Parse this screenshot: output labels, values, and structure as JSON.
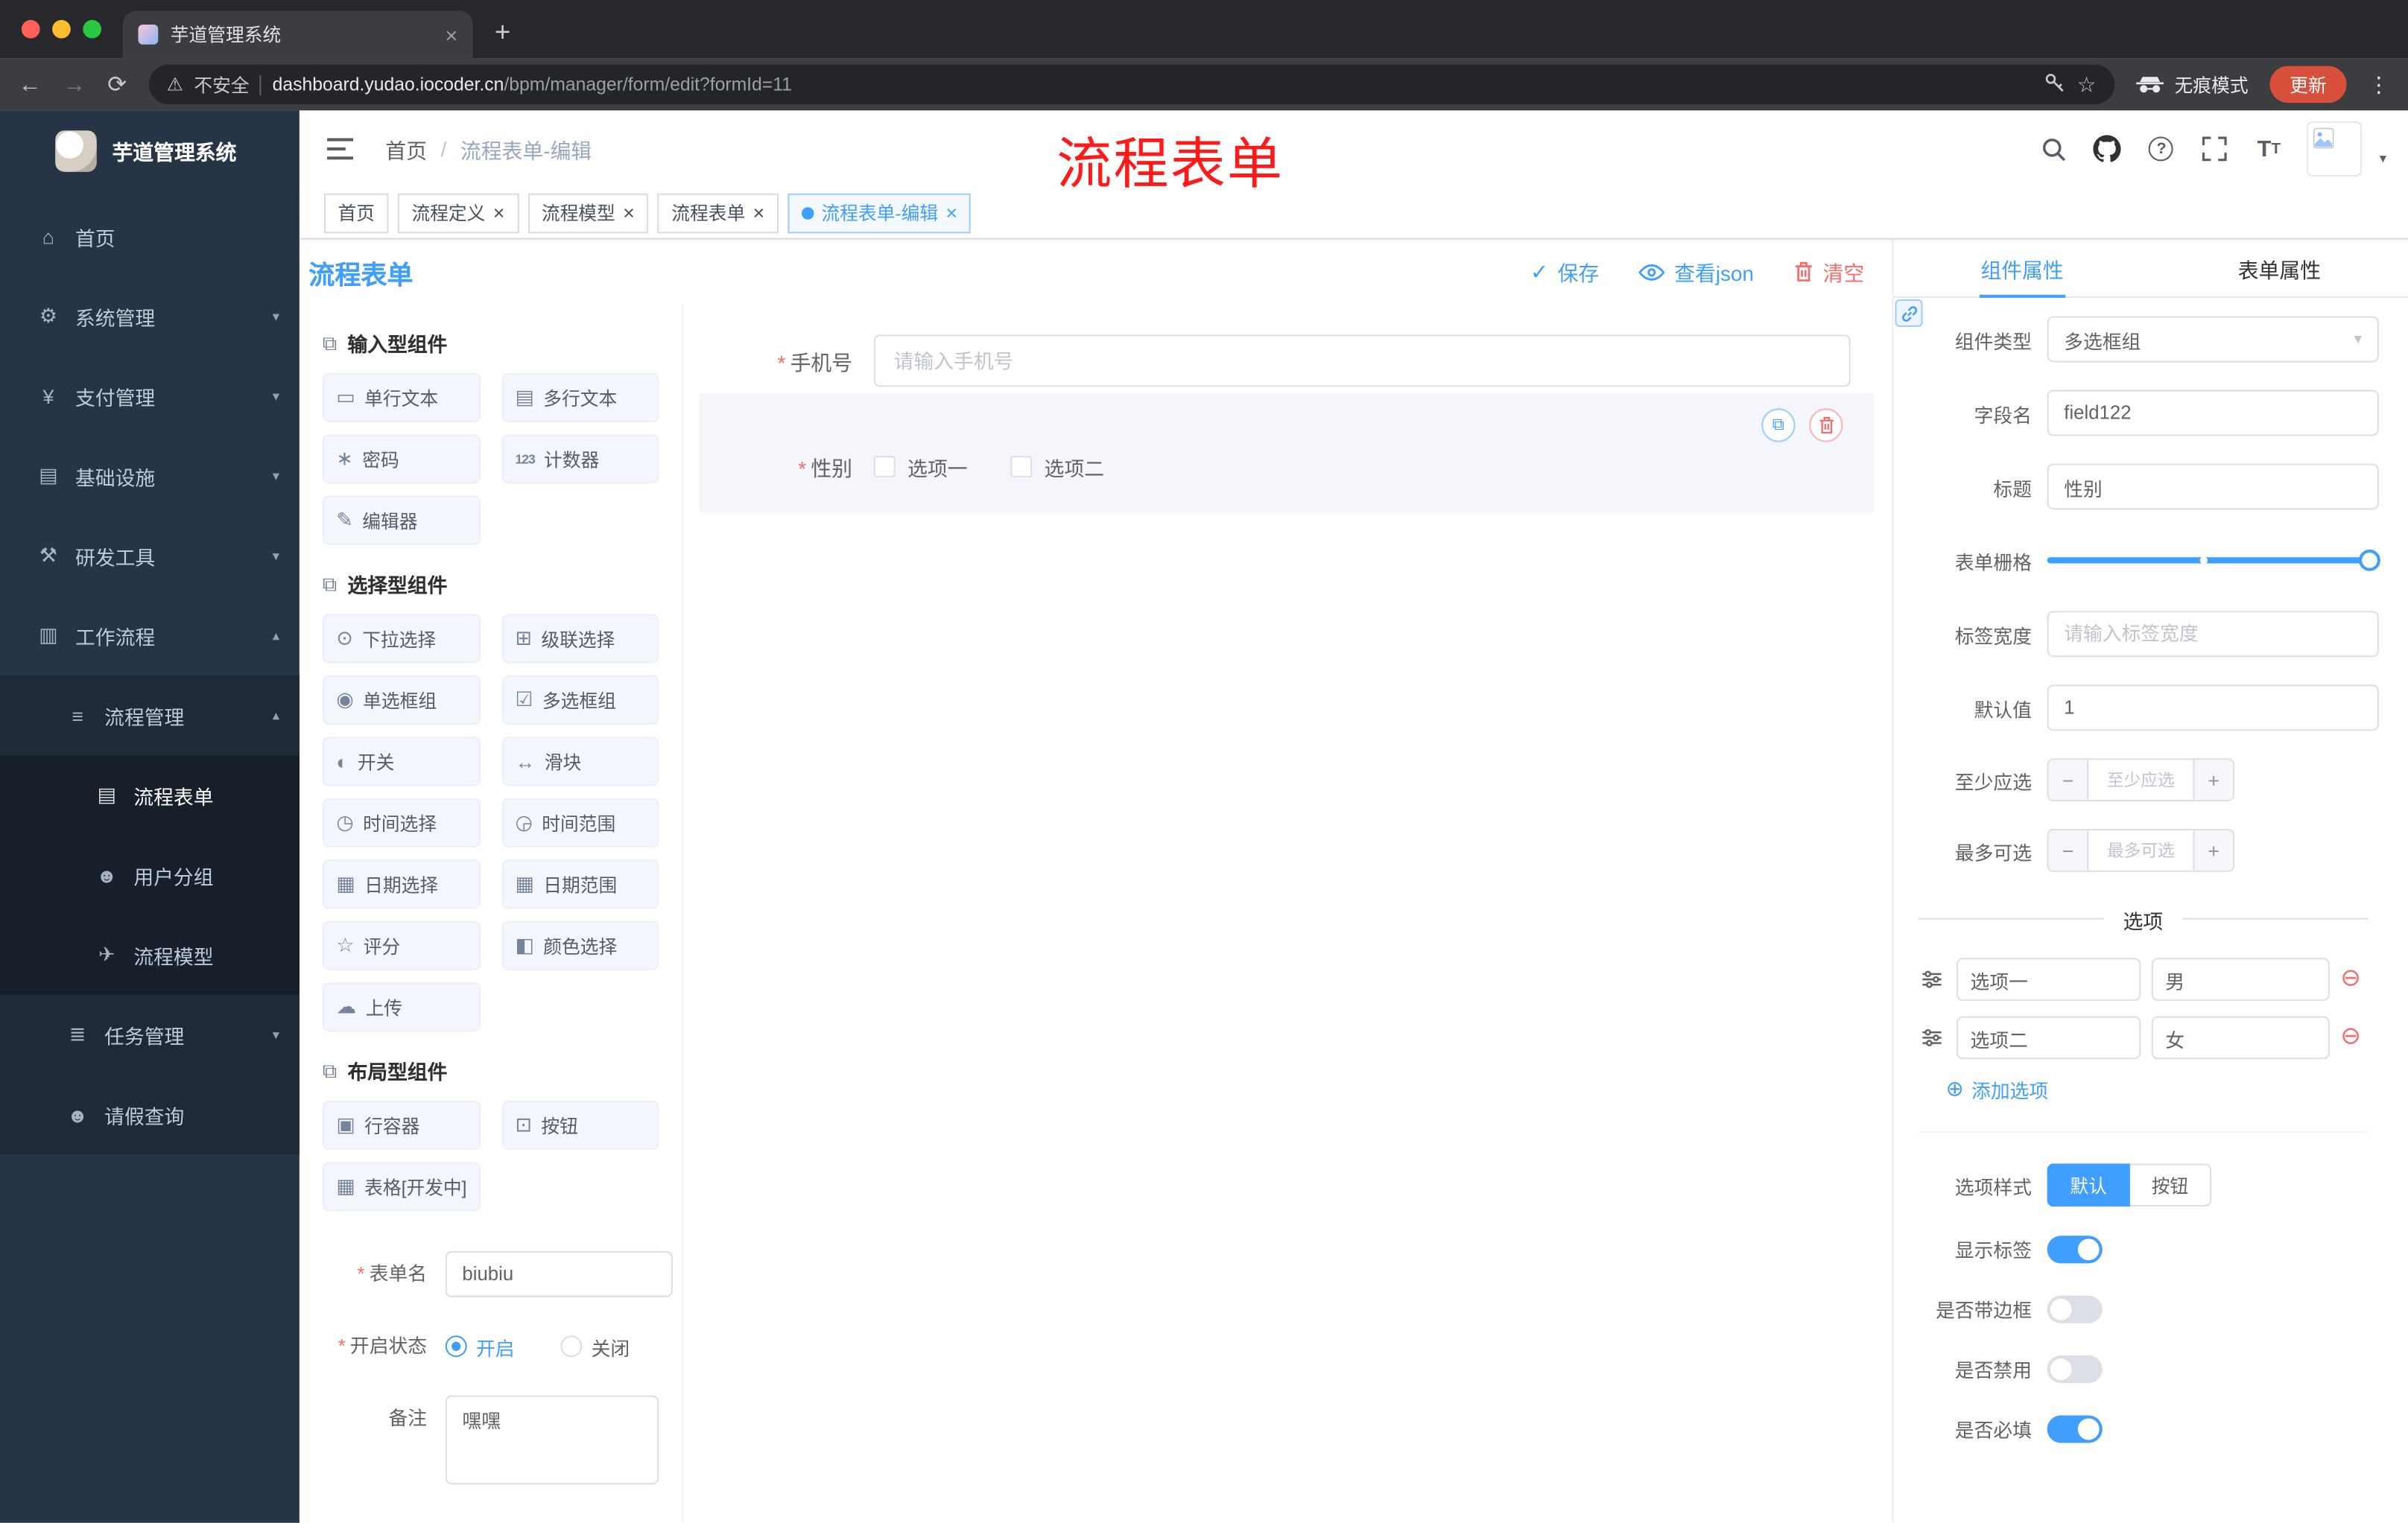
{
  "browser": {
    "tab_title": "芋道管理系统",
    "security_label": "不安全",
    "url_domain": "dashboard.yudao.iocoder.cn",
    "url_path": "/bpm/manager/form/edit?formId=11",
    "incognito_label": "无痕模式",
    "update_label": "更新"
  },
  "annotation": {
    "text": "流程表单",
    "color": "#ff1a1a"
  },
  "sidebar": {
    "logo_title": "芋道管理系统",
    "items": [
      {
        "label": "首页",
        "icon": "home-icon",
        "depth": 1
      },
      {
        "label": "系统管理",
        "icon": "gear-icon",
        "depth": 1,
        "chevron": "down"
      },
      {
        "label": "支付管理",
        "icon": "yen-icon",
        "depth": 1,
        "chevron": "down"
      },
      {
        "label": "基础设施",
        "icon": "infra-icon",
        "depth": 1,
        "chevron": "down"
      },
      {
        "label": "研发工具",
        "icon": "tools-icon",
        "depth": 1,
        "chevron": "down"
      },
      {
        "label": "工作流程",
        "icon": "workflow-icon",
        "depth": 1,
        "chevron": "up"
      },
      {
        "label": "流程管理",
        "icon": "list-icon",
        "depth": 2,
        "chevron": "up"
      },
      {
        "label": "流程表单",
        "icon": "form-icon",
        "depth": 3,
        "active": true
      },
      {
        "label": "用户分组",
        "icon": "users-icon",
        "depth": 3
      },
      {
        "label": "流程模型",
        "icon": "model-icon",
        "depth": 3
      },
      {
        "label": "任务管理",
        "icon": "task-icon",
        "depth": 2,
        "chevron": "down"
      },
      {
        "label": "请假查询",
        "icon": "leave-icon",
        "depth": 2
      }
    ]
  },
  "breadcrumb": {
    "home": "首页",
    "current": "流程表单-编辑"
  },
  "tags": [
    {
      "label": "首页",
      "closable": false,
      "active": false
    },
    {
      "label": "流程定义",
      "closable": true,
      "active": false
    },
    {
      "label": "流程模型",
      "closable": true,
      "active": false
    },
    {
      "label": "流程表单",
      "closable": true,
      "active": false
    },
    {
      "label": "流程表单-编辑",
      "closable": true,
      "active": true
    }
  ],
  "designer": {
    "title": "流程表单",
    "toolbar": {
      "save": "保存",
      "view_json": "查看json",
      "clear": "清空"
    },
    "palette": {
      "groups": [
        {
          "title": "输入型组件",
          "icon": "component-icon",
          "items": [
            {
              "label": "单行文本",
              "icon": "input-icon"
            },
            {
              "label": "多行文本",
              "icon": "textarea-icon"
            },
            {
              "label": "密码",
              "icon": "password-icon"
            },
            {
              "label": "计数器",
              "icon": "counter-icon"
            },
            {
              "label": "编辑器",
              "icon": "editor-icon"
            }
          ]
        },
        {
          "title": "选择型组件",
          "icon": "component-icon",
          "items": [
            {
              "label": "下拉选择",
              "icon": "select-icon"
            },
            {
              "label": "级联选择",
              "icon": "cascader-icon"
            },
            {
              "label": "单选框组",
              "icon": "radio-group-icon"
            },
            {
              "label": "多选框组",
              "icon": "checkbox-group-icon"
            },
            {
              "label": "开关",
              "icon": "switch-icon"
            },
            {
              "label": "滑块",
              "icon": "slider-icon"
            },
            {
              "label": "时间选择",
              "icon": "time-icon"
            },
            {
              "label": "时间范围",
              "icon": "time-range-icon"
            },
            {
              "label": "日期选择",
              "icon": "date-icon"
            },
            {
              "label": "日期范围",
              "icon": "date-range-icon"
            },
            {
              "label": "评分",
              "icon": "rate-icon"
            },
            {
              "label": "颜色选择",
              "icon": "color-icon"
            },
            {
              "label": "上传",
              "icon": "upload-icon"
            }
          ]
        },
        {
          "title": "布局型组件",
          "icon": "component-icon",
          "items": [
            {
              "label": "行容器",
              "icon": "row-icon"
            },
            {
              "label": "按钮",
              "icon": "button-icon"
            },
            {
              "label": "表格[开发中]",
              "icon": "table-icon"
            }
          ]
        }
      ]
    },
    "meta": {
      "name_label": "表单名",
      "name_value": "biubiu",
      "status_label": "开启状态",
      "status_on": "开启",
      "status_off": "关闭",
      "remark_label": "备注",
      "remark_value": "嘿嘿"
    },
    "canvas": {
      "phone_label": "手机号",
      "phone_placeholder": "请输入手机号",
      "gender_label": "性别",
      "gender_options": [
        "选项一",
        "选项二"
      ]
    }
  },
  "props": {
    "tabs": [
      "组件属性",
      "表单属性"
    ],
    "component_type_label": "组件类型",
    "component_type_value": "多选框组",
    "field_label": "字段名",
    "field_value": "field122",
    "title_label": "标题",
    "title_value": "性别",
    "grid_label": "表单栅格",
    "label_width_label": "标签宽度",
    "label_width_placeholder": "请输入标签宽度",
    "default_label": "默认值",
    "default_value": "1",
    "min_label": "至少应选",
    "min_placeholder": "至少应选",
    "max_label": "最多可选",
    "max_placeholder": "最多可选",
    "options_title": "选项",
    "options": [
      {
        "label": "选项一",
        "value": "男"
      },
      {
        "label": "选项二",
        "value": "女"
      }
    ],
    "add_option_label": "添加选项",
    "style_label": "选项样式",
    "style_default": "默认",
    "style_button": "按钮",
    "switches": [
      {
        "label": "显示标签",
        "on": true
      },
      {
        "label": "是否带边框",
        "on": false
      },
      {
        "label": "是否禁用",
        "on": false
      },
      {
        "label": "是否必填",
        "on": true
      }
    ]
  },
  "colors": {
    "accent": "#409eff",
    "danger": "#f56c6c",
    "sidebar_bg": "#263445"
  }
}
